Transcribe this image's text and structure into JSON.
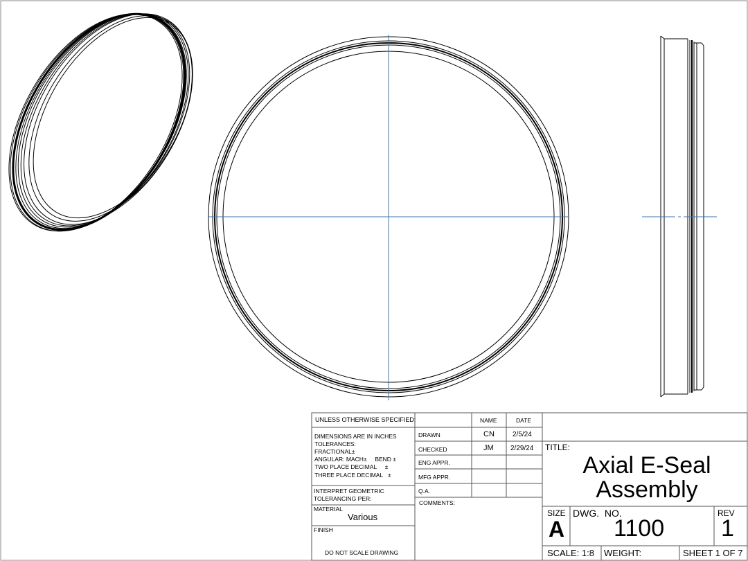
{
  "tolerance_block": {
    "unless_specified": "UNLESS OTHERWISE SPECIFIED:",
    "dimensions": "DIMENSIONS ARE IN INCHES",
    "tolerances": "TOLERANCES:",
    "fractional": "FRACTIONAL±",
    "angular": "ANGULAR: MACH±     BEND ±",
    "two_place": "TWO PLACE DECIMAL     ±",
    "three_place": "THREE PLACE DECIMAL   ±",
    "interpret_1": "INTERPRET GEOMETRIC",
    "interpret_2": "TOLERANCING PER:",
    "material_label": "MATERIAL",
    "material_value": "Various",
    "finish_label": "FINISH",
    "do_not_scale": "DO NOT SCALE DRAWING"
  },
  "approvals": {
    "name_header": "NAME",
    "date_header": "DATE",
    "rows": [
      {
        "label": "DRAWN",
        "name": "CN",
        "date": "2/5/24"
      },
      {
        "label": "CHECKED",
        "name": "JM",
        "date": "2/29/24"
      },
      {
        "label": "ENG APPR.",
        "name": "",
        "date": ""
      },
      {
        "label": "MFG APPR.",
        "name": "",
        "date": ""
      },
      {
        "label": "Q.A.",
        "name": "",
        "date": ""
      }
    ],
    "comments_label": "COMMENTS:"
  },
  "title_block": {
    "title_label": "TITLE:",
    "title_line1": "Axial E-Seal",
    "title_line2": "Assembly",
    "size_label": "SIZE",
    "size_value": "A",
    "dwg_no_label": "DWG.  NO.",
    "dwg_no_value": "1100",
    "rev_label": "REV",
    "rev_value": "1",
    "scale": "SCALE: 1:8",
    "weight": "WEIGHT:",
    "sheet": "SHEET 1 OF 7"
  },
  "colors": {
    "centerline": "#2b7bc4",
    "line": "#000000"
  }
}
